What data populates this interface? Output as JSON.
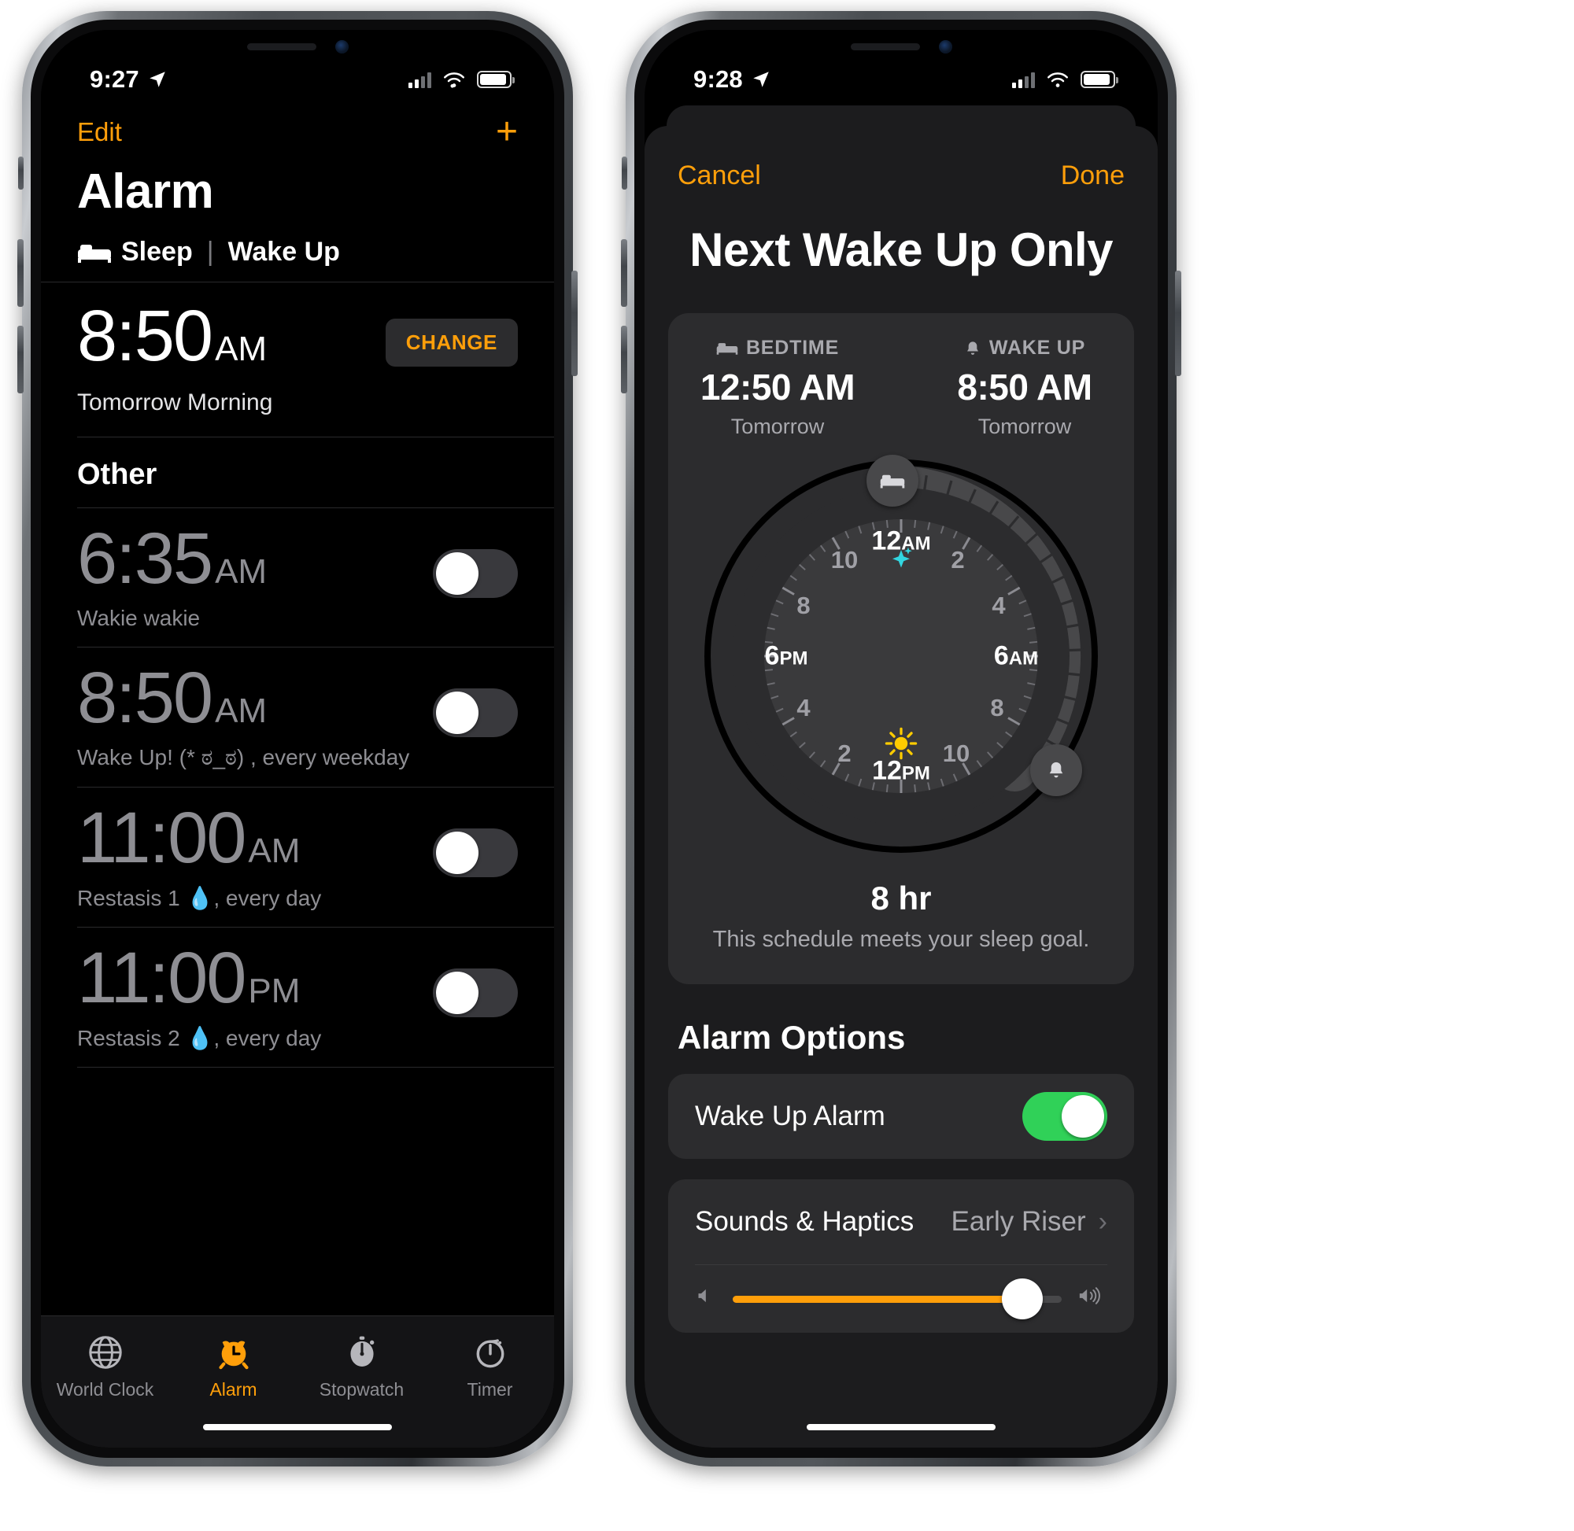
{
  "left_phone": {
    "status_bar": {
      "time": "9:27",
      "location_icon": "location-arrow-icon",
      "wifi_icon": "wifi-icon",
      "battery_icon": "battery-icon",
      "signal_icon": "cellular-signal-icon"
    },
    "nav": {
      "edit_label": "Edit",
      "add_icon": "plus-icon"
    },
    "page_title": "Alarm",
    "sleep_section": {
      "bed_icon": "bed-icon",
      "sleep_label": "Sleep",
      "separator": "|",
      "wake_label": "Wake Up"
    },
    "wake_alarm": {
      "time": "8:50",
      "meridiem": "AM",
      "sub_label": "Tomorrow Morning",
      "change_button": "CHANGE"
    },
    "other_header": "Other",
    "alarms": [
      {
        "time": "6:35",
        "meridiem": "AM",
        "label": "Wakie wakie",
        "enabled": false
      },
      {
        "time": "8:50",
        "meridiem": "AM",
        "label": "Wake Up! (* ಠ_ಠ) , every weekday",
        "enabled": false
      },
      {
        "time": "11:00",
        "meridiem": "AM",
        "label": "Restasis 1 💧, every day",
        "enabled": false
      },
      {
        "time": "11:00",
        "meridiem": "PM",
        "label": "Restasis 2 💧, every day",
        "enabled": false
      }
    ],
    "tabs": [
      {
        "label": "World Clock",
        "icon": "globe-icon",
        "active": false
      },
      {
        "label": "Alarm",
        "icon": "alarm-clock-icon",
        "active": true
      },
      {
        "label": "Stopwatch",
        "icon": "stopwatch-icon",
        "active": false
      },
      {
        "label": "Timer",
        "icon": "timer-icon",
        "active": false
      }
    ]
  },
  "right_phone": {
    "status_bar": {
      "time": "9:28",
      "location_icon": "location-arrow-icon",
      "wifi_icon": "wifi-icon",
      "battery_icon": "battery-icon",
      "signal_icon": "cellular-signal-icon"
    },
    "sheet_nav": {
      "cancel_label": "Cancel",
      "done_label": "Done"
    },
    "sheet_title": "Next Wake Up Only",
    "schedule": {
      "bedtime": {
        "caption": "BEDTIME",
        "icon": "bed-icon",
        "time": "12:50 AM",
        "day": "Tomorrow"
      },
      "wakeup": {
        "caption": "WAKE UP",
        "icon": "bell-icon",
        "time": "8:50 AM",
        "day": "Tomorrow"
      },
      "duration": "8 hr",
      "duration_note": "This schedule meets your sleep goal.",
      "dial": {
        "key_labels": [
          "12AM",
          "6AM",
          "12PM",
          "6PM"
        ],
        "minor_labels": [
          "2",
          "4",
          "8",
          "10",
          "2",
          "4",
          "8",
          "10"
        ],
        "moon_icon": "sparkle-moon-icon",
        "sun_icon": "sun-icon",
        "bed_handle_icon": "bed-icon",
        "wake_handle_icon": "bell-icon"
      }
    },
    "options_header": "Alarm Options",
    "options": [
      {
        "label": "Wake Up Alarm",
        "type": "toggle",
        "enabled": true
      },
      {
        "label": "Sounds & Haptics",
        "type": "disclosure",
        "value": "Early Riser",
        "chevron": "chevron-right-icon"
      }
    ],
    "volume": {
      "min_icon": "speaker-min-icon",
      "max_icon": "speaker-max-icon",
      "level_percent": 88
    }
  },
  "colors": {
    "accent_orange": "#ff9f0a",
    "toggle_green": "#30d158",
    "sun_yellow": "#ffcc00",
    "moon_cyan": "#32d6e0"
  }
}
